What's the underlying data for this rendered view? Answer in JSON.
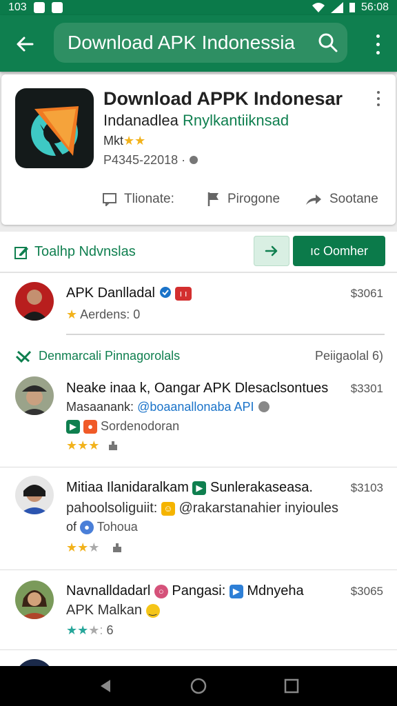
{
  "status_bar": {
    "time_left": "103",
    "time_right": "56:08"
  },
  "toolbar": {
    "search_query": "Download APK Indonessia"
  },
  "app": {
    "title": "Download APPK Indonesar",
    "subtitle_plain": "Indanadlea",
    "subtitle_green": "Rnylkantiiknsad",
    "rating_label": "Mkt",
    "rating_stars": "★★",
    "meta": "P4345-22018",
    "meta_sep": "·",
    "actions": [
      {
        "label": "Tlionate:",
        "icon": "comment-icon"
      },
      {
        "label": "Pirogone",
        "icon": "flag-icon"
      },
      {
        "label": "Sootane",
        "icon": "share-icon"
      }
    ]
  },
  "section": {
    "title": "Toalhp Ndvnslas",
    "cta_label": "ıc Oomher"
  },
  "featured": {
    "name": "APK Danlladal",
    "badge": "ı ı",
    "price": "$3061",
    "star": "★",
    "rating_text": "Aerdens: 0"
  },
  "subsection": {
    "title": "Denmarcali Pinnagorolals",
    "right": "Peiigaolal 6)"
  },
  "comments": [
    {
      "name": "Neake inaa k, Oangar APK Dlesaclsontues",
      "price": "$3301",
      "line2_plain": "Masaanank:",
      "line2_link": "@boaanallonaba API",
      "line3": "Sordenodoran",
      "stars_full": "★★",
      "stars_half": "★"
    },
    {
      "name": "Mitiaa Ilanidaralkam",
      "name_after": "Sunlerakaseasa.",
      "price": "$3103",
      "line2_plain": "pahoolsoliguiit:",
      "line2_rest": "@rakarstanahier inyioules",
      "line3_pre": "of",
      "line3": "Tohoua",
      "stars_full": "★★",
      "stars_empty": "★"
    },
    {
      "name": "Navnalldadarl",
      "name_mid": "Pangasi:",
      "name_after": "Mdnyeha",
      "price": "$3065",
      "line2_plain": "APK Malkan",
      "stars_full": "★★",
      "stars_half": "★:",
      "count": "6"
    }
  ],
  "colors": {
    "primary": "#0f7f4f",
    "accent": "#f2b21b",
    "link": "#1a73c9"
  }
}
